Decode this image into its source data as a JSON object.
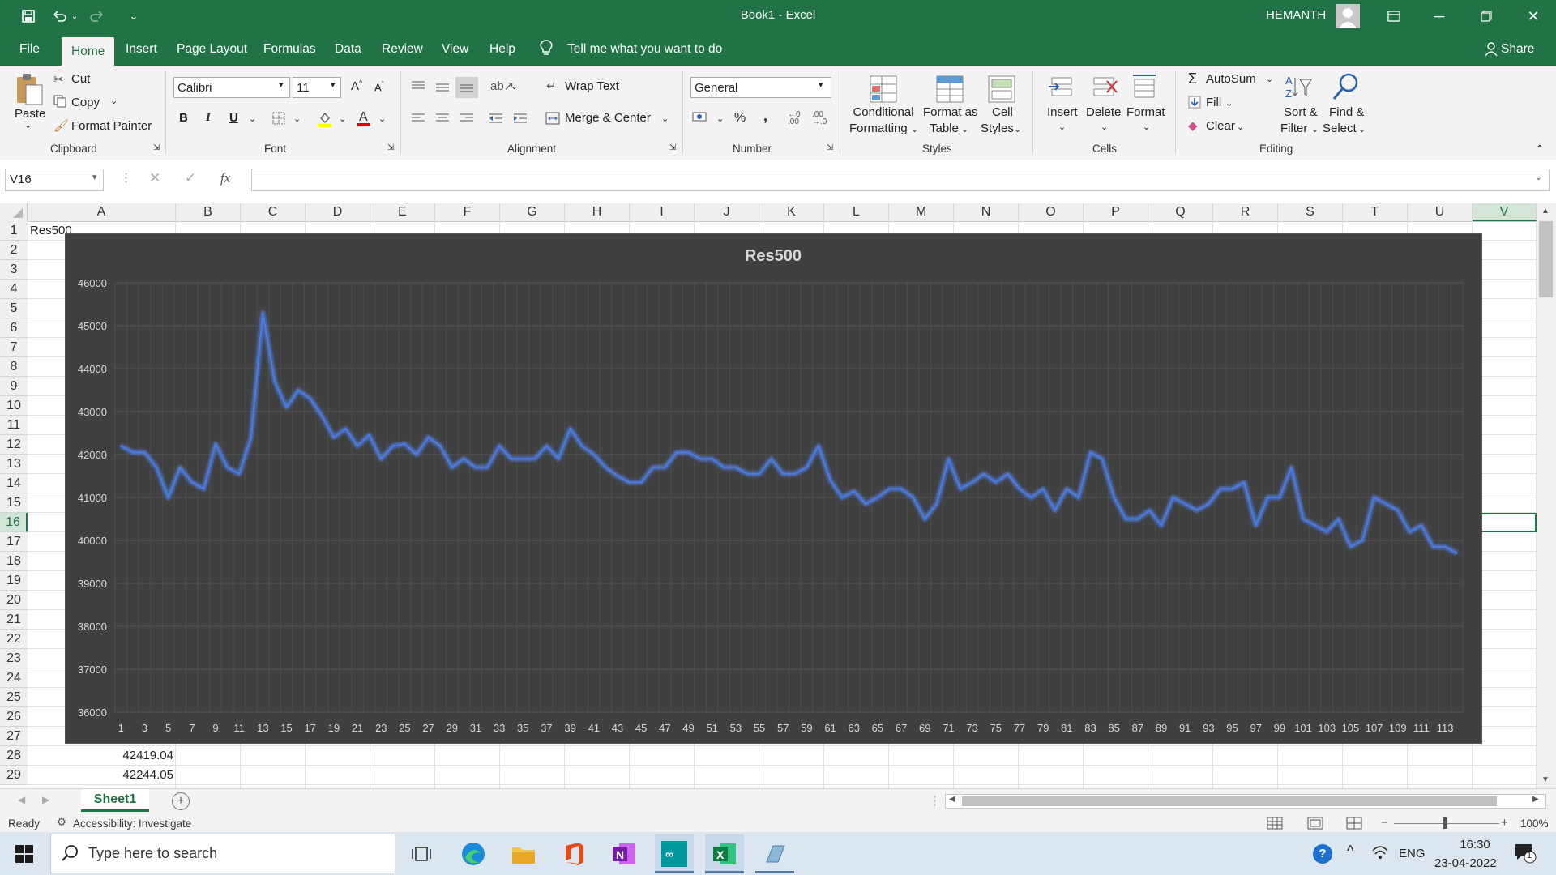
{
  "window": {
    "title": "Book1 - Excel",
    "user": "HEMANTH"
  },
  "tabs": [
    "File",
    "Home",
    "Insert",
    "Page Layout",
    "Formulas",
    "Data",
    "Review",
    "View",
    "Help"
  ],
  "tell_me": "Tell me what you want to do",
  "share": "Share",
  "ribbon": {
    "clipboard": {
      "paste": "Paste",
      "cut": "Cut",
      "copy": "Copy",
      "format_painter": "Format Painter",
      "label": "Clipboard"
    },
    "font": {
      "name": "Calibri",
      "size": "11",
      "label": "Font",
      "bold": "B",
      "italic": "I",
      "underline": "U"
    },
    "alignment": {
      "wrap": "Wrap Text",
      "merge": "Merge & Center",
      "label": "Alignment"
    },
    "number": {
      "format": "General",
      "percent": "%",
      "comma": ",",
      "label": "Number"
    },
    "styles": {
      "conditional1": "Conditional",
      "conditional2": "Formatting",
      "format_table1": "Format as",
      "format_table2": "Table",
      "cell_styles1": "Cell",
      "cell_styles2": "Styles",
      "label": "Styles"
    },
    "cells": {
      "insert": "Insert",
      "delete": "Delete",
      "format": "Format",
      "label": "Cells"
    },
    "editing": {
      "autosum": "AutoSum",
      "fill": "Fill",
      "clear": "Clear",
      "sort1": "Sort &",
      "sort2": "Filter",
      "find1": "Find &",
      "find2": "Select",
      "label": "Editing"
    }
  },
  "formula_bar": {
    "name_box": "V16",
    "fx": "fx",
    "value": ""
  },
  "columns": [
    "A",
    "B",
    "C",
    "D",
    "E",
    "F",
    "G",
    "H",
    "I",
    "J",
    "K",
    "L",
    "M",
    "N",
    "O",
    "P",
    "Q",
    "R",
    "S",
    "T",
    "U",
    "V"
  ],
  "rows": [
    "1",
    "2",
    "3",
    "4",
    "5",
    "6",
    "7",
    "8",
    "9",
    "10",
    "11",
    "12",
    "13",
    "14",
    "15",
    "16",
    "17",
    "18",
    "19",
    "20",
    "21",
    "22",
    "23",
    "24",
    "25",
    "26",
    "27",
    "28",
    "29"
  ],
  "cells": {
    "A1": "Res500",
    "A28": "42419.04",
    "A29": "42244.05"
  },
  "sheet": {
    "name": "Sheet1"
  },
  "status": {
    "ready": "Ready",
    "accessibility": "Accessibility: Investigate",
    "zoom": "100%"
  },
  "taskbar": {
    "search_placeholder": "Type here to search",
    "lang": "ENG",
    "time": "16:30",
    "date": "23-04-2022",
    "notif": "1"
  },
  "colors": {
    "excel_green": "#217346",
    "chart_bg": "#404040",
    "line": "#4a7ce0"
  },
  "chart_data": {
    "type": "line",
    "title": "Res500",
    "xlabel": "",
    "ylabel": "",
    "ylim": [
      36000,
      46000
    ],
    "yticks": [
      36000,
      37000,
      38000,
      39000,
      40000,
      41000,
      42000,
      43000,
      44000,
      45000,
      46000
    ],
    "xtick_labels": [
      "1",
      "3",
      "5",
      "7",
      "9",
      "11",
      "13",
      "15",
      "17",
      "19",
      "21",
      "23",
      "25",
      "27",
      "29",
      "31",
      "33",
      "35",
      "37",
      "39",
      "41",
      "43",
      "45",
      "47",
      "49",
      "51",
      "53",
      "55",
      "57",
      "59",
      "61",
      "63",
      "65",
      "67",
      "69",
      "71",
      "73",
      "75",
      "77",
      "79",
      "81",
      "83",
      "85",
      "87",
      "89",
      "91",
      "93",
      "95",
      "97",
      "99",
      "101",
      "103",
      "105",
      "107",
      "109",
      "111",
      "113"
    ],
    "x": [
      1,
      2,
      3,
      4,
      5,
      6,
      7,
      8,
      9,
      10,
      11,
      12,
      13,
      14,
      15,
      16,
      17,
      18,
      19,
      20,
      21,
      22,
      23,
      24,
      25,
      26,
      27,
      28,
      29,
      30,
      31,
      32,
      33,
      34,
      35,
      36,
      37,
      38,
      39,
      40,
      41,
      42,
      43,
      44,
      45,
      46,
      47,
      48,
      49,
      50,
      51,
      52,
      53,
      54,
      55,
      56,
      57,
      58,
      59,
      60,
      61,
      62,
      63,
      64,
      65,
      66,
      67,
      68,
      69,
      70,
      71,
      72,
      73,
      74,
      75,
      76,
      77,
      78,
      79,
      80,
      81,
      82,
      83,
      84,
      85,
      86,
      87,
      88,
      89,
      90,
      91,
      92,
      93,
      94,
      95,
      96,
      97,
      98,
      99,
      100,
      101,
      102,
      103,
      104,
      105,
      106,
      107,
      108,
      109,
      110,
      111,
      112,
      113,
      114
    ],
    "series": [
      {
        "values": [
          42200,
          42050,
          42050,
          41700,
          41000,
          41700,
          41350,
          41200,
          42250,
          41700,
          41550,
          42400,
          45300,
          43700,
          43100,
          43500,
          43300,
          42900,
          42400,
          42600,
          42200,
          42450,
          41900,
          42200,
          42250,
          42000,
          42400,
          42200,
          41700,
          41900,
          41700,
          41700,
          42200,
          41900,
          41900,
          41900,
          42200,
          41900,
          42600,
          42200,
          42000,
          41700,
          41500,
          41350,
          41350,
          41700,
          41700,
          42050,
          42050,
          41900,
          41900,
          41700,
          41700,
          41550,
          41550,
          41900,
          41550,
          41550,
          41700,
          42200,
          41400,
          41000,
          41150,
          40850,
          41000,
          41200,
          41200,
          41000,
          40500,
          40850,
          41900,
          41200,
          41350,
          41550,
          41350,
          41550,
          41200,
          41000,
          41200,
          40700,
          41200,
          41000,
          42050,
          41900,
          41000,
          40500,
          40500,
          40700,
          40350,
          41000,
          40850,
          40700,
          40850,
          41200,
          41200,
          41350,
          40350,
          41000,
          41000,
          41700,
          40500,
          40350,
          40200,
          40500,
          39850,
          40000,
          41000,
          40850,
          40700,
          40200,
          40350,
          39850,
          39850,
          39700
        ]
      }
    ]
  }
}
